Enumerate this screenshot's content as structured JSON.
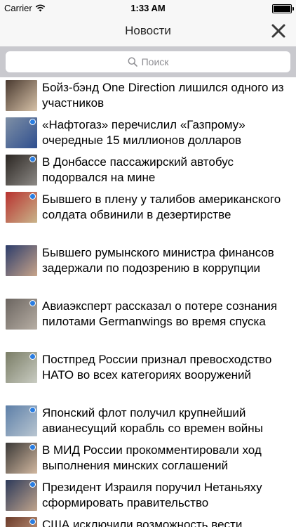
{
  "status_bar": {
    "carrier": "Carrier",
    "time": "1:33 AM"
  },
  "nav": {
    "title": "Новости",
    "close_icon": "close-icon"
  },
  "search": {
    "placeholder": "Поиск",
    "icon": "search-icon"
  },
  "news": [
    {
      "headline": "Бойз-бэнд One Direction лишился одного из участников",
      "unread": false,
      "thumb_colors": [
        "#4a3a30",
        "#d7c2a8"
      ]
    },
    {
      "headline": "«Нафтогаз» перечислил «Газпрому» очередные 15 миллионов долларов",
      "unread": true,
      "thumb_colors": [
        "#7e8fa5",
        "#2f4f8f"
      ]
    },
    {
      "headline": "В Донбассе пассажирский автобус подорвался на мине",
      "unread": true,
      "thumb_colors": [
        "#2b2622",
        "#8d8a86"
      ]
    },
    {
      "headline": "Бывшего в плену у талибов американского солдата обвинили в дезертирстве",
      "unread": true,
      "thumb_colors": [
        "#b8322f",
        "#c9b48a"
      ]
    },
    {
      "headline": "Бывшего румынского министра финансов задержали по подозрению в коррупции",
      "unread": false,
      "thumb_colors": [
        "#2d3d6b",
        "#c8a48a"
      ]
    },
    {
      "headline": "Авиаэксперт рассказал о потере сознания пилотами Germanwings во время спуска",
      "unread": true,
      "thumb_colors": [
        "#6b6560",
        "#b7aea4"
      ]
    },
    {
      "headline": "Постпред России признал превосходство НАТО во всех категориях вооружений",
      "unread": true,
      "thumb_colors": [
        "#7a7d66",
        "#c9ccc2"
      ]
    },
    {
      "headline": "Японский флот получил крупнейший авианесущий корабль со времен войны",
      "unread": true,
      "thumb_colors": [
        "#5d7fa8",
        "#b9c6d1"
      ]
    },
    {
      "headline": "В МИД России прокомментировали ход выполнения минских соглашений",
      "unread": true,
      "thumb_colors": [
        "#3b3937",
        "#d2b8a0"
      ]
    },
    {
      "headline": "Президент Израиля поручил Нетаньяху сформировать правительство",
      "unread": true,
      "thumb_colors": [
        "#2d3a5a",
        "#c0a48c"
      ]
    },
    {
      "headline": "США исключили возможность вести",
      "unread": true,
      "thumb_colors": [
        "#6b3b2a",
        "#d1a88c"
      ]
    }
  ],
  "colors": {
    "unread_dot": "#2a7de1",
    "navbar_bg": "#f7f7f7",
    "search_bg": "#c9c9ce"
  }
}
